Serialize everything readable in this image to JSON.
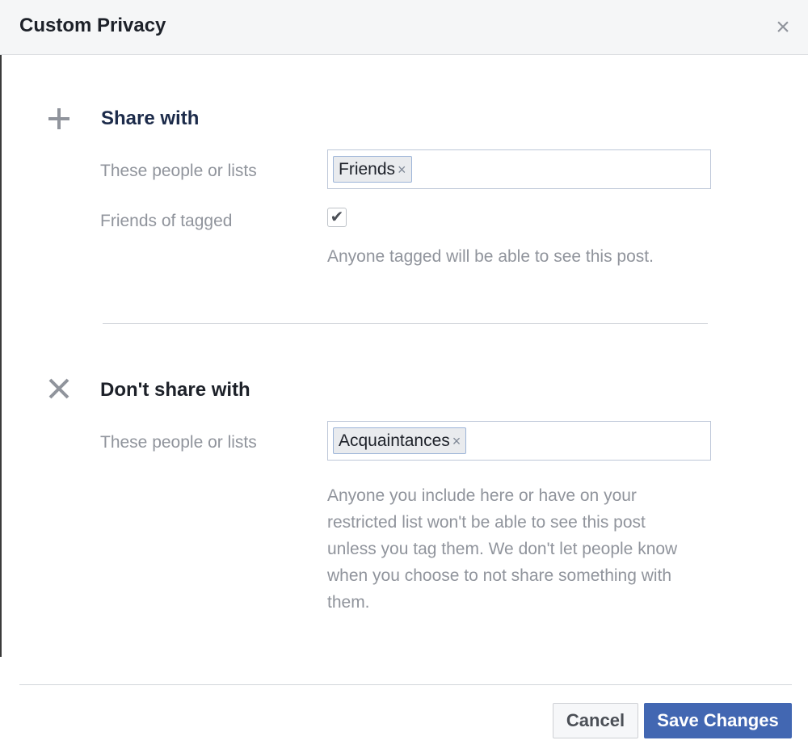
{
  "dialog": {
    "title": "Custom Privacy",
    "close_glyph": "×"
  },
  "share_with": {
    "icon": "plus-icon",
    "title": "Share with",
    "people_label": "These people or lists",
    "token": "Friends",
    "token_remove_glyph": "×",
    "friends_of_tagged_label": "Friends of tagged",
    "friends_of_tagged_checked": true,
    "checkmark_glyph": "✔",
    "tagged_help": "Anyone tagged will be able to see this post."
  },
  "dont_share_with": {
    "icon": "x-icon",
    "title": "Don't share with",
    "people_label": "These people or lists",
    "token": "Acquaintances",
    "token_remove_glyph": "×",
    "help_lines": [
      "Anyone you include here or have on your",
      "restricted list won't be able to see this post",
      "unless you tag them. We don't let people know",
      "when you choose to not share something with",
      "them."
    ]
  },
  "footer": {
    "cancel_label": "Cancel",
    "save_label": "Save Changes"
  },
  "colors": {
    "primary": "#4267b2",
    "muted_text": "#90949c",
    "header_bg": "#f5f6f7"
  }
}
